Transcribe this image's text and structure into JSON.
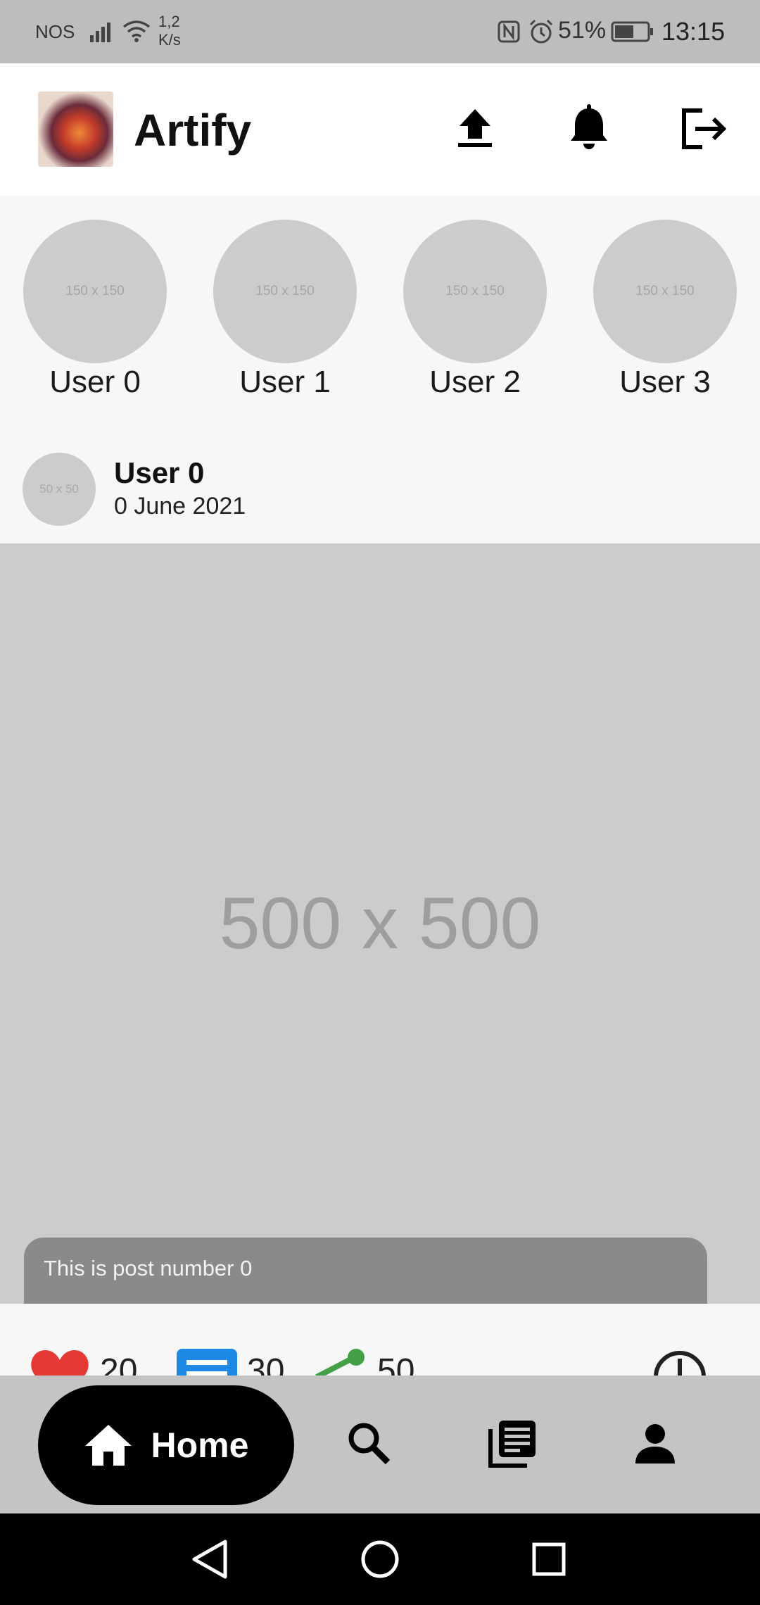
{
  "status_bar": {
    "carrier": "NOS",
    "speed_value": "1,2",
    "speed_unit": "K/s",
    "battery": "51%",
    "time": "13:15"
  },
  "header": {
    "title": "Artify",
    "icons": [
      "upload-icon",
      "bell-icon",
      "logout-icon"
    ]
  },
  "stories": [
    {
      "name": "User 0",
      "placeholder": "150 x 150"
    },
    {
      "name": "User 1",
      "placeholder": "150 x 150"
    },
    {
      "name": "User 2",
      "placeholder": "150 x 150"
    },
    {
      "name": "User 3",
      "placeholder": "150 x 150"
    }
  ],
  "post": {
    "avatar_placeholder": "50 x 50",
    "user": "User 0",
    "date": "0 June 2021",
    "image_placeholder": "500 x 500",
    "caption": "This is post number 0",
    "likes": "20",
    "comments": "30",
    "shares": "50"
  },
  "bottom_nav": {
    "home_label": "Home",
    "icons": [
      "home-icon",
      "search-icon",
      "feed-icon",
      "profile-icon"
    ]
  },
  "colors": {
    "like": "#e53935",
    "comment": "#1e88e5",
    "share": "#43a047",
    "nav_bar": "#c4c4c4",
    "status_bar": "#bdbdbd"
  }
}
